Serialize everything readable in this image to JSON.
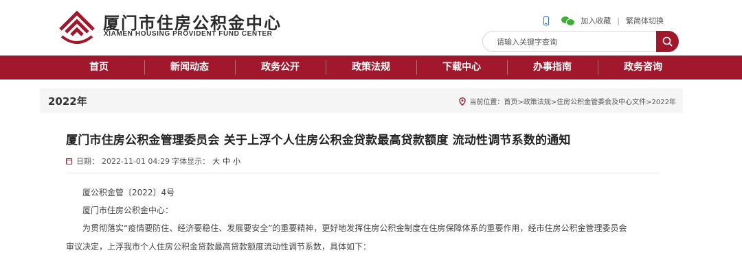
{
  "header": {
    "brand_cn": "厦门市住房公积金中心",
    "brand_en": "XIAMEN HOUSING PROVIDENT FUND CENTER",
    "links": {
      "favorite": "加入收藏",
      "separator": "|",
      "switch": "繁简体切换"
    },
    "search": {
      "placeholder": "请输入关键字查询",
      "value": ""
    },
    "icons": [
      "phone-icon",
      "wechat-icon",
      "search-icon"
    ],
    "accent_color": "#a1182c"
  },
  "nav": {
    "items": [
      "首页",
      "新闻动态",
      "政务公开",
      "政策法规",
      "下载中心",
      "办事指南",
      "政务咨询"
    ]
  },
  "pagebar": {
    "title": "2022年",
    "breadcrumb": "当前位置：首页>政策法规>住房公积金管委会及中心文件>2022年"
  },
  "article": {
    "title": "厦门市住房公积金管理委员会 关于上浮个人住房公积金贷款最高贷款额度 流动性调节系数的通知",
    "meta": {
      "date_label": "日期：",
      "date": "2022-11-01 04:29",
      "font_label": "字体显示：",
      "font_large": "大",
      "font_medium": "中",
      "font_small": "小"
    },
    "paragraphs": [
      "厦公积金管〔2022〕4号",
      "厦门市住房公积金中心：",
      "为贯彻落实“疫情要防住、经济要稳住、发展要安全”的重要精神，更好地发挥住房公积金制度在住房保障体系的重要作用，经市住房公积金管理委员会",
      "审议决定，上浮我市个人住房公积金贷款最高贷款额度流动性调节系数，具体如下："
    ]
  }
}
